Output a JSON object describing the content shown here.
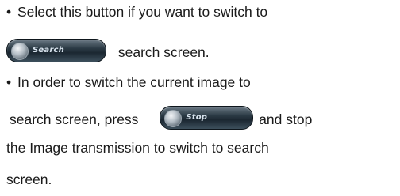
{
  "bullet": "•",
  "lines": {
    "l1": "Select this button if you want to switch to",
    "l2_after": "search screen.",
    "l3": "In order to switch the current image to",
    "l4_before": "search screen, press",
    "l4_after": "and stop",
    "l5": "the Image transmission to switch to search",
    "l6": "screen."
  },
  "buttons": {
    "search_label": "Search",
    "stop_label": "Stop"
  }
}
